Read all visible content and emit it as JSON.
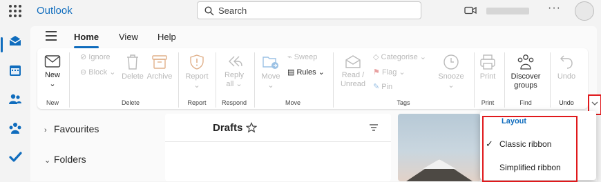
{
  "app": {
    "brand": "Outlook"
  },
  "search": {
    "placeholder": "Search"
  },
  "header": {
    "more": "···"
  },
  "tabs": [
    {
      "label": "Home",
      "active": true
    },
    {
      "label": "View"
    },
    {
      "label": "Help"
    }
  ],
  "ribbon": {
    "new": {
      "label": "New",
      "group": "New"
    },
    "delete": {
      "ignore": "Ignore",
      "block": "Block",
      "delete": "Delete",
      "archive": "Archive",
      "group": "Delete"
    },
    "report": {
      "label": "Report",
      "group": "Report"
    },
    "respond": {
      "reply_all_1": "Reply",
      "reply_all_2": "all",
      "group": "Respond"
    },
    "move": {
      "move": "Move",
      "sweep": "Sweep",
      "rules": "Rules",
      "group": "Move"
    },
    "tags": {
      "read_1": "Read /",
      "read_2": "Unread",
      "categorise": "Categorise",
      "flag": "Flag",
      "pin": "Pin",
      "snooze": "Snooze",
      "group": "Tags"
    },
    "print": {
      "label": "Print",
      "group": "Print"
    },
    "find": {
      "label_1": "Discover",
      "label_2": "groups",
      "group": "Find"
    },
    "undo": {
      "label": "Undo",
      "group": "Undo"
    }
  },
  "folders": {
    "favourites": "Favourites",
    "folders": "Folders"
  },
  "list": {
    "title": "Drafts"
  },
  "menu": {
    "heading": "Layout",
    "items": [
      {
        "label": "Classic ribbon",
        "checked": true
      },
      {
        "label": "Simplified ribbon",
        "checked": false
      }
    ]
  },
  "colors": {
    "accent": "#0f6cbd",
    "highlight": "#e0191c"
  }
}
